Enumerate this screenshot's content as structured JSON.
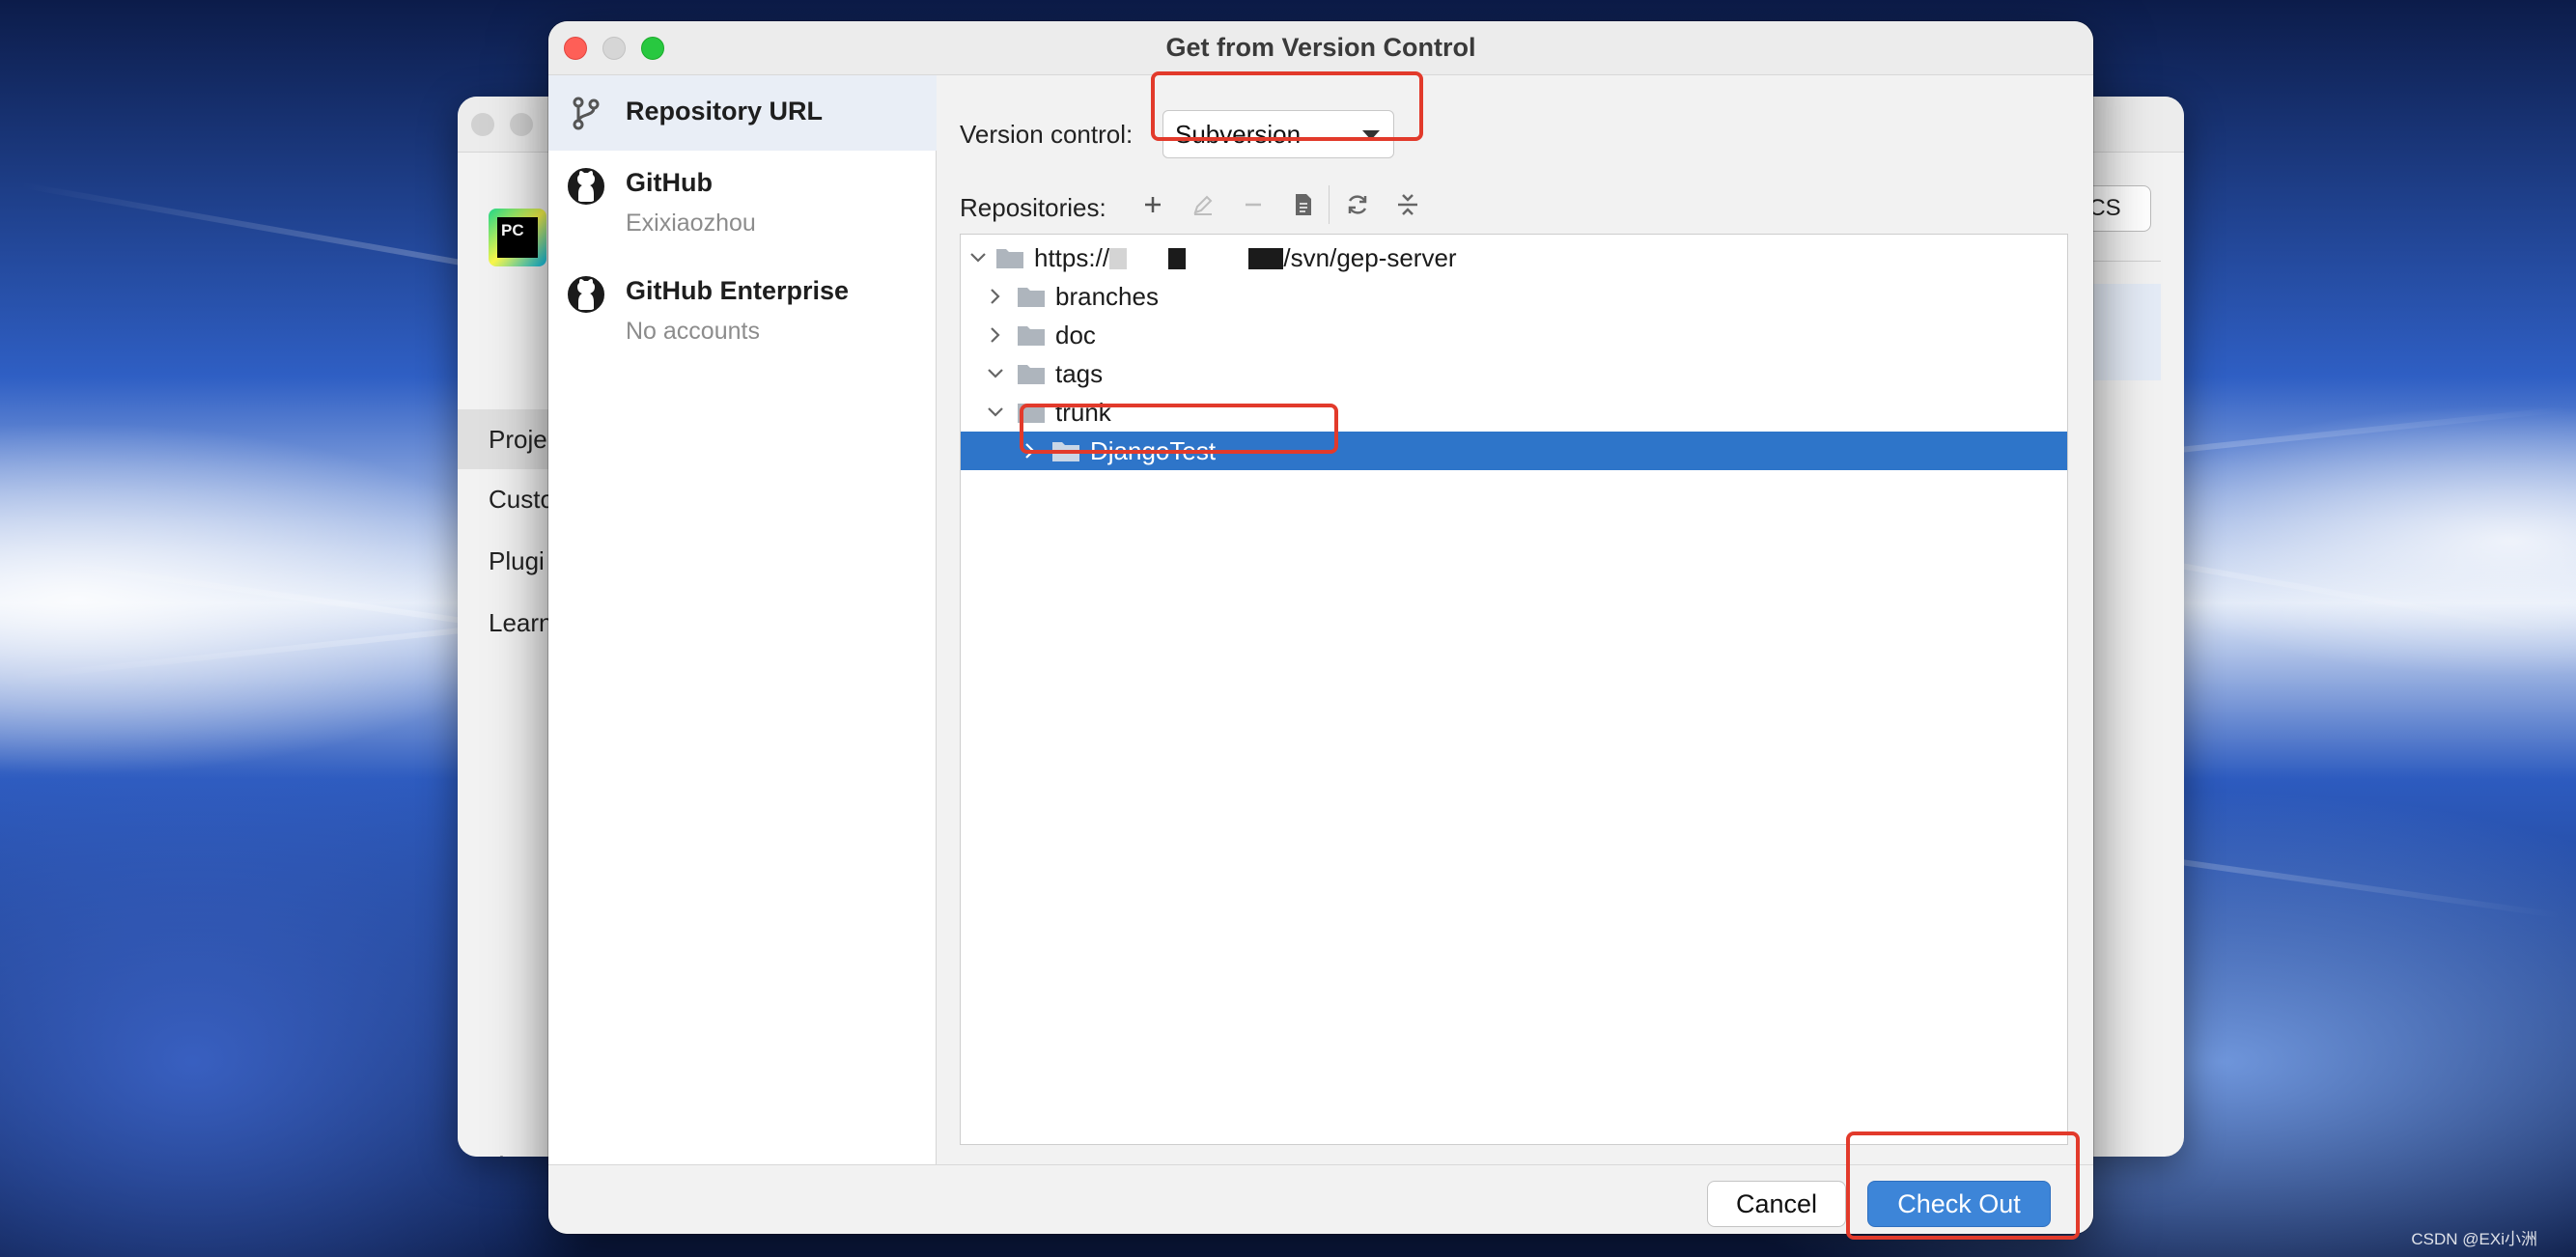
{
  "dialog": {
    "title": "Get from Version Control"
  },
  "background_window": {
    "nav_items": [
      "Proje",
      "Custo",
      "Plugi",
      "Learn"
    ],
    "logo_text": "PC",
    "right_button_label": "CS"
  },
  "sources": [
    {
      "title": "Repository URL",
      "subtitle": "",
      "icon": "git-branch-icon",
      "selected": true
    },
    {
      "title": "GitHub",
      "subtitle": "Exixiaozhou",
      "icon": "github-icon",
      "selected": false
    },
    {
      "title": "GitHub Enterprise",
      "subtitle": "No accounts",
      "icon": "github-icon",
      "selected": false
    }
  ],
  "version_control": {
    "label": "Version control:",
    "value": "Subversion"
  },
  "repositories": {
    "label": "Repositories:",
    "toolbar_icons": [
      "add-icon",
      "edit-icon",
      "remove-icon",
      "browse-icon",
      "refresh-icon",
      "collapse-all-icon"
    ]
  },
  "tree": {
    "root_prefix": "https://",
    "root_suffix": "/svn/gep-server",
    "nodes": [
      {
        "label": "branches",
        "expanded": false
      },
      {
        "label": "doc",
        "expanded": false
      },
      {
        "label": "tags",
        "expanded": true
      },
      {
        "label": "trunk",
        "expanded": true
      },
      {
        "label": "DjangoTest",
        "expanded": false,
        "selected": true
      }
    ]
  },
  "footer": {
    "cancel_label": "Cancel",
    "checkout_label": "Check Out"
  },
  "colors": {
    "selection_blue": "#2e75c9",
    "primary_button": "#3d85d8",
    "annotation_red": "#e23a2b",
    "close_light": "#fe5f57",
    "zoom_light": "#28c840"
  },
  "watermark": "CSDN @EXi小洲"
}
